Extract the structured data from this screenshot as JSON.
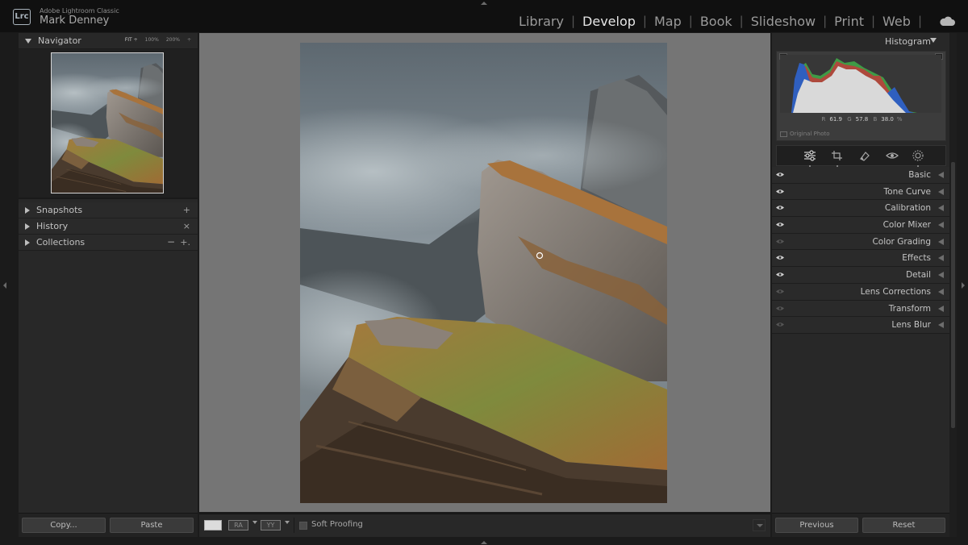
{
  "app": {
    "logo_text": "Lrc",
    "product_name": "Adobe Lightroom Classic",
    "user_name": "Mark Denney"
  },
  "modules": [
    {
      "label": "Library",
      "active": false
    },
    {
      "label": "Develop",
      "active": true
    },
    {
      "label": "Map",
      "active": false
    },
    {
      "label": "Book",
      "active": false
    },
    {
      "label": "Slideshow",
      "active": false
    },
    {
      "label": "Print",
      "active": false
    },
    {
      "label": "Web",
      "active": false
    }
  ],
  "navigator": {
    "title": "Navigator",
    "zoom_fit": "FIT ÷",
    "zoom_100": "100%",
    "zoom_200": "200%",
    "zoom_more": "÷"
  },
  "left_sections": {
    "snapshots": {
      "label": "Snapshots",
      "action": "+"
    },
    "history": {
      "label": "History",
      "action": "×"
    },
    "collections": {
      "label": "Collections",
      "action_minus": "−",
      "action_plus": "+."
    }
  },
  "left_buttons": {
    "copy": "Copy...",
    "paste": "Paste"
  },
  "toolbar": {
    "soft_proofing_label": "Soft Proofing",
    "soft_proofing_checked": false,
    "compare_ra": "RA",
    "compare_yy": "YY"
  },
  "histogram": {
    "title": "Histogram",
    "r_label": "R",
    "r_value": "61.9",
    "g_label": "G",
    "g_value": "57.8",
    "b_label": "B",
    "b_value": "38.0",
    "unit": "%",
    "original_photo_label": "Original Photo"
  },
  "develop_panels": [
    {
      "label": "Basic",
      "visible": true
    },
    {
      "label": "Tone Curve",
      "visible": true
    },
    {
      "label": "Calibration",
      "visible": true
    },
    {
      "label": "Color Mixer",
      "visible": true
    },
    {
      "label": "Color Grading",
      "visible": false
    },
    {
      "label": "Effects",
      "visible": true
    },
    {
      "label": "Detail",
      "visible": true
    },
    {
      "label": "Lens Corrections",
      "visible": false
    },
    {
      "label": "Transform",
      "visible": false
    },
    {
      "label": "Lens Blur",
      "visible": false
    }
  ],
  "right_buttons": {
    "previous": "Previous",
    "reset": "Reset"
  },
  "colors": {
    "accent_active": "#e6e6e6",
    "panel_bg": "#282828",
    "center_bg": "#757575",
    "hist_red": "#c23b3b",
    "hist_green": "#3f9b46",
    "hist_blue": "#2f5fbf"
  },
  "icons": [
    "cloud-icon",
    "sliders-icon",
    "crop-icon",
    "heal-icon",
    "redeye-icon",
    "mask-icon",
    "eye-icon"
  ]
}
